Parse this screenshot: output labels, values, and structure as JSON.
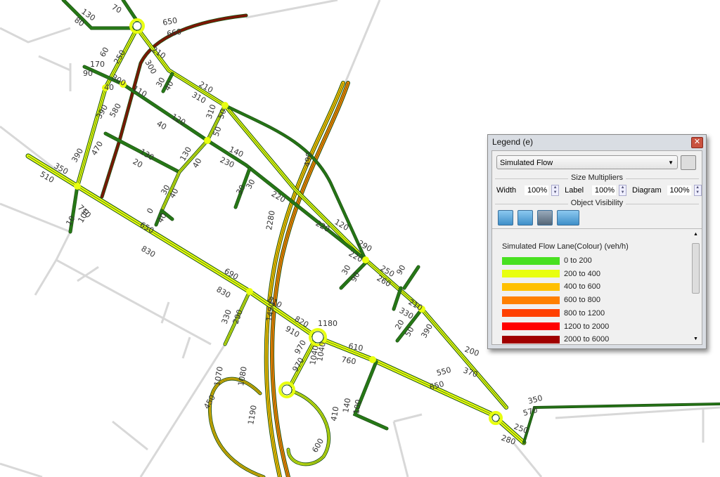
{
  "map": {
    "flow_labels": [
      "130",
      "80",
      "70",
      "650",
      "660",
      "60",
      "250",
      "210",
      "300",
      "170",
      "90",
      "300",
      "40",
      "110",
      "30",
      "40",
      "210",
      "310",
      "390",
      "580",
      "120",
      "40",
      "310",
      "50",
      "50",
      "130",
      "20",
      "140",
      "230",
      "470",
      "390",
      "350",
      "510",
      "130",
      "40",
      "30",
      "30",
      "30",
      "40",
      "220",
      "710",
      "0",
      "40",
      "100",
      "10",
      "650",
      "830",
      "2280",
      "490",
      "220",
      "120",
      "290",
      "220",
      "30",
      "90",
      "250",
      "260",
      "90",
      "690",
      "830",
      "810",
      "330",
      "290",
      "1490",
      "820",
      "910",
      "1180",
      "210",
      "330",
      "20",
      "50",
      "390",
      "610",
      "760",
      "970",
      "970",
      "1040",
      "1040",
      "200",
      "370",
      "550",
      "650",
      "1070",
      "1080",
      "450",
      "1190",
      "140",
      "100",
      "410",
      "600",
      "350",
      "570",
      "250",
      "280"
    ],
    "colors": {
      "green": "#2c8a1a",
      "light_green": "#48e020",
      "yellow": "#e8ff10",
      "amber": "#ffc000",
      "orange": "#ff8000",
      "red_orange": "#ff4000",
      "red": "#ff0000",
      "dark_red": "#a00000",
      "background_road": "#d8d8d8"
    }
  },
  "legend": {
    "title": "Legend (e)",
    "close_icon": "close-icon",
    "layer_select": "Simulated Flow",
    "size_multipliers_heading": "Size Multipliers",
    "width_label": "Width",
    "width_value": "100%",
    "label_label": "Label",
    "label_value": "100%",
    "diagram_label": "Diagram",
    "diagram_value": "100%",
    "object_visibility_heading": "Object Visibility",
    "visibility_icons": [
      "nodes-icon",
      "links-icon",
      "zones-icon",
      "circle-dropdown-icon"
    ],
    "heading": "Simulated Flow Lane(Colour) (veh/h)",
    "items": [
      {
        "label": "0 to 200",
        "color": "#48e020"
      },
      {
        "label": "200 to 400",
        "color": "#e8ff10"
      },
      {
        "label": "400 to 600",
        "color": "#ffc000"
      },
      {
        "label": "600 to 800",
        "color": "#ff8000"
      },
      {
        "label": "800 to 1200",
        "color": "#ff4000"
      },
      {
        "label": "1200 to 2000",
        "color": "#ff0000"
      },
      {
        "label": "2000 to 6000",
        "color": "#a00000"
      }
    ]
  }
}
